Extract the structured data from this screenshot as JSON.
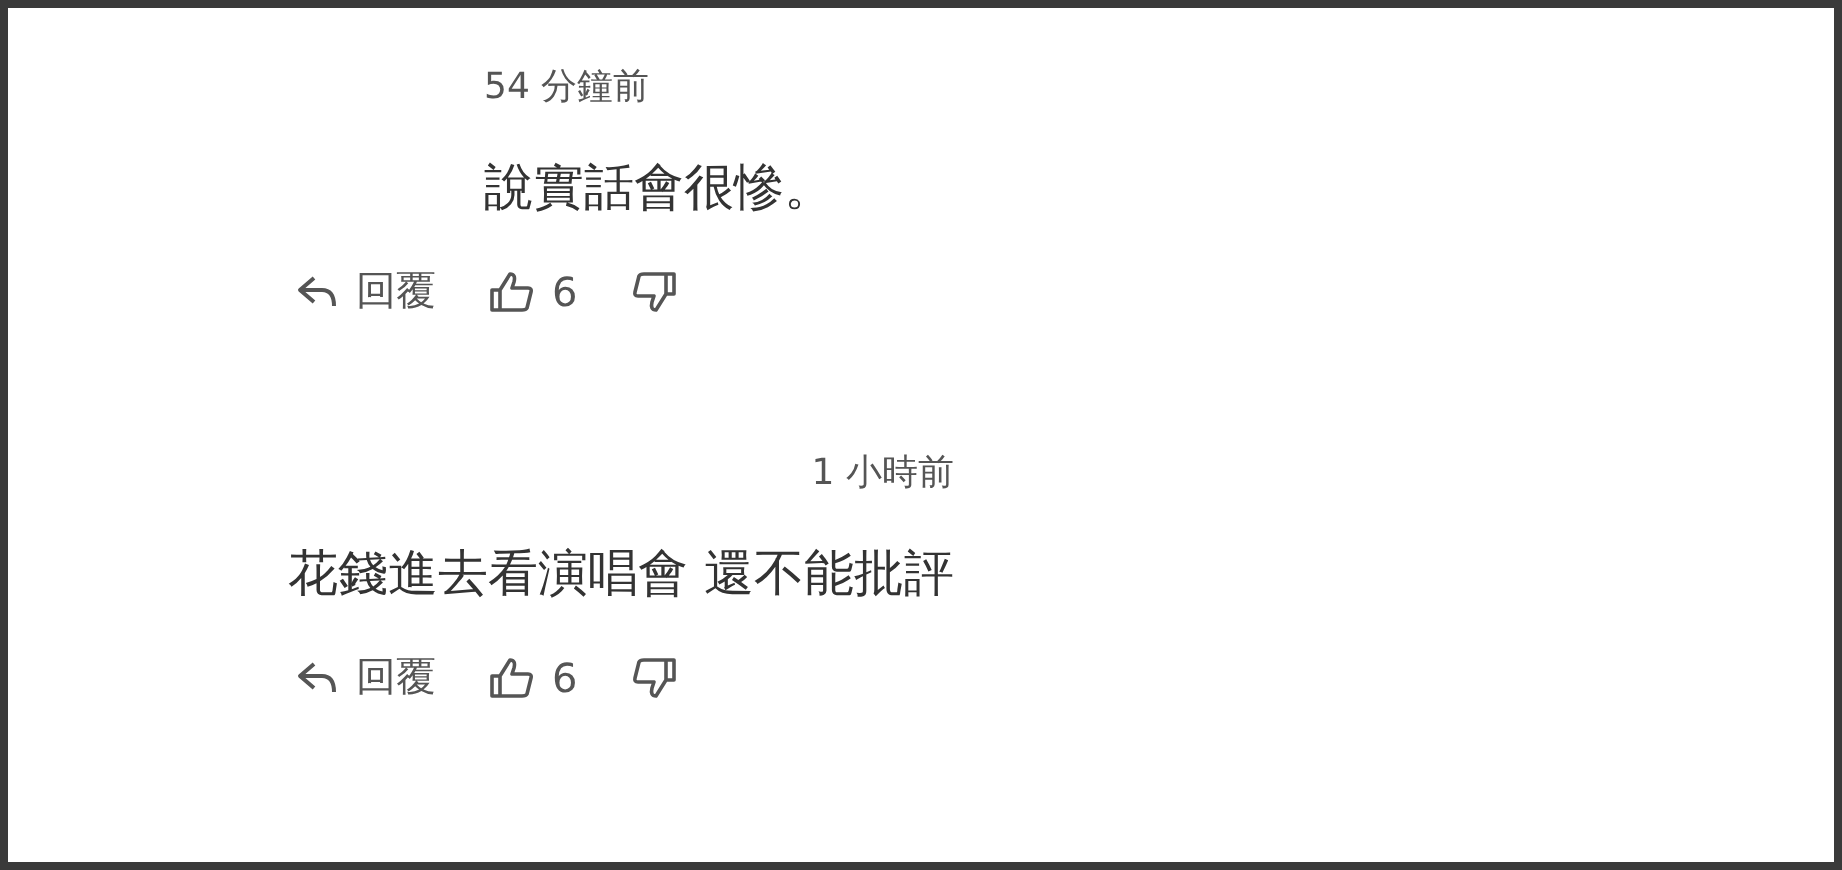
{
  "comments": [
    {
      "time": "54 分鐘前",
      "text": "說實話會很慘。",
      "reply": "回覆",
      "likes": "6"
    },
    {
      "time": "1 小時前",
      "text": "花錢進去看演唱會 還不能批評",
      "reply": "回覆",
      "likes": "6"
    }
  ]
}
